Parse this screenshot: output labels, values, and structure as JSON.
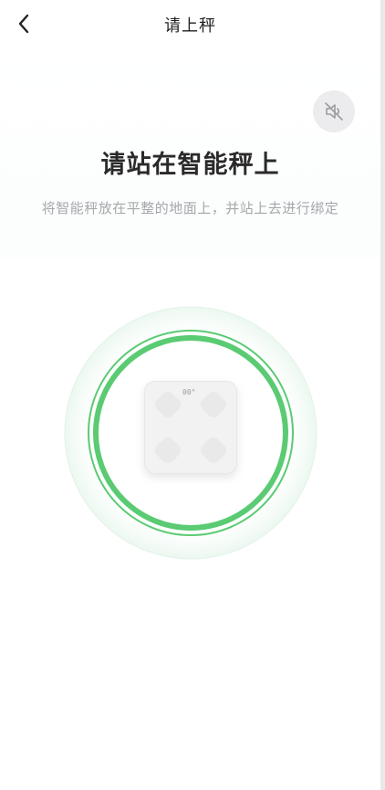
{
  "header": {
    "title": "请上秤",
    "back_icon": "chevron-left-icon"
  },
  "mute_button": {
    "icon": "speaker-muted-icon"
  },
  "headline": "请站在智能秤上",
  "subtitle": "将智能秤放在平整的地面上，并站上去进行绑定",
  "scale": {
    "display_text": "00°"
  },
  "colors": {
    "accent_green": "#5acb73",
    "text_primary": "#2a2a2a",
    "text_secondary": "#a4a7aa",
    "mute_button_bg": "#ececef"
  }
}
